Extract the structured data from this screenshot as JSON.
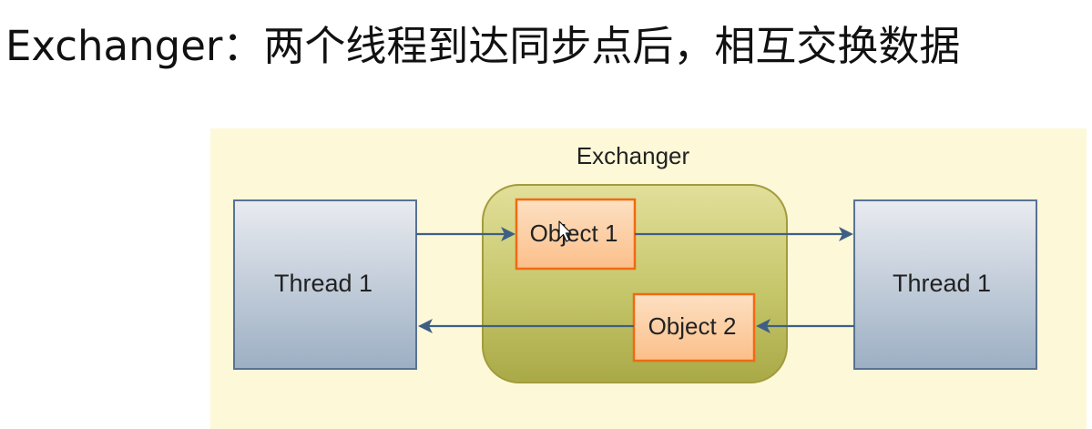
{
  "title": "Exchanger：两个线程到达同步点后，相互交换数据",
  "diagram": {
    "exchanger_label": "Exchanger",
    "left_thread_label": "Thread 1",
    "right_thread_label": "Thread 1",
    "object1_label": "Object 1",
    "object2_label": "Object 2"
  },
  "colors": {
    "background_panel": "#fdf8d8",
    "exchanger_fill": "#c5c86a",
    "exchanger_stroke": "#a39b3d",
    "object_fill": "#fcc99b",
    "object_stroke": "#f06a12",
    "thread_fill_top": "#e9ebf0",
    "thread_fill_bottom": "#9cafc3",
    "thread_stroke": "#5a7294",
    "arrow": "#3e5f84"
  }
}
